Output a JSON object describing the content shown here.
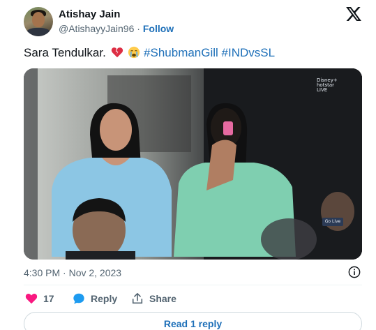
{
  "author": {
    "name": "Atishay Jain",
    "handle": "@AtishayyJain96",
    "separator": "·",
    "follow_label": "Follow"
  },
  "tweet": {
    "text_prefix": "Sara Tendulkar.",
    "emojis": [
      "broken-heart",
      "crying-face"
    ],
    "hashtags": [
      "#ShubmanGill",
      "#INDvsSL"
    ]
  },
  "media": {
    "kind": "photo",
    "description_icons": [
      "broadcast-logo",
      "go-live-badge"
    ],
    "overlay_logo_text": "Disney+ hotstar LIVE",
    "overlay_badge_text": "Go Live"
  },
  "meta": {
    "time": "4:30 PM · Nov 2, 2023"
  },
  "actions": {
    "like_count": "17",
    "reply_label": "Reply",
    "share_label": "Share"
  },
  "footer": {
    "read_replies_label": "Read 1 reply"
  },
  "colors": {
    "link_blue": "#1d6fb8",
    "like_pink": "#f91880",
    "reply_blue": "#1d9bf0",
    "muted_gray": "#536471"
  }
}
